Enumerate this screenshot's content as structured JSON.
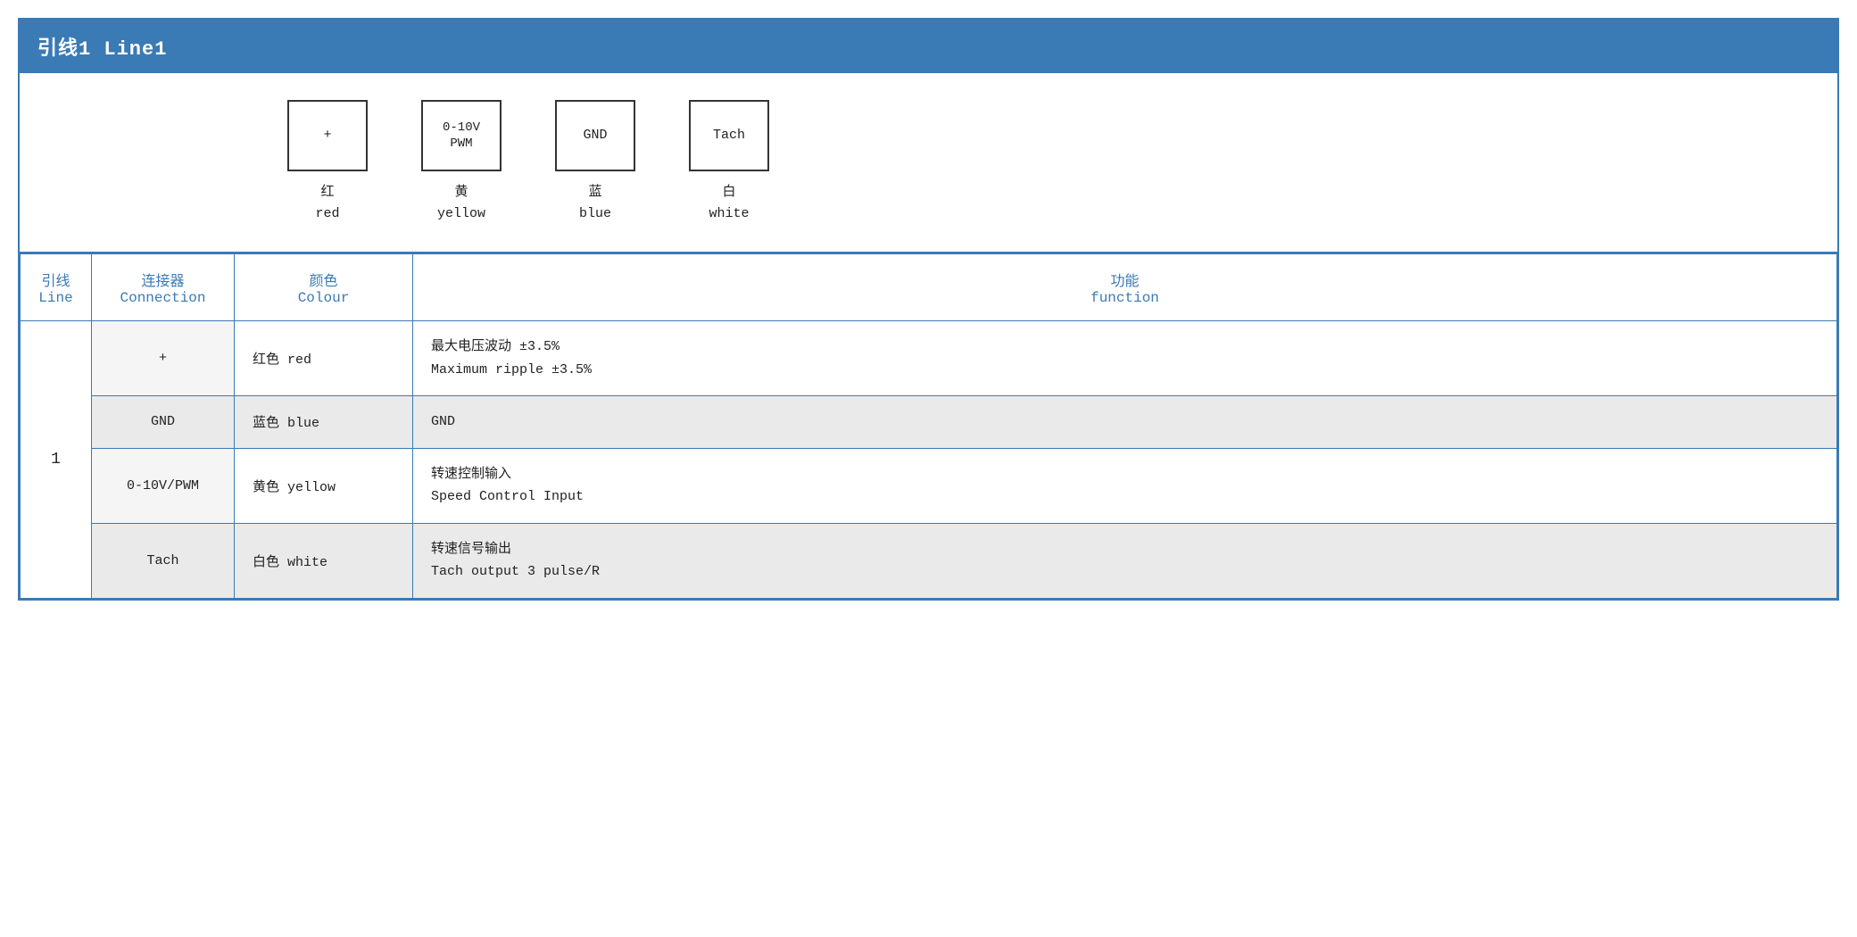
{
  "header": {
    "title": "引线1 Line1"
  },
  "diagram": {
    "connectors": [
      {
        "symbol": "+",
        "label_cn": "红",
        "label_en": "red"
      },
      {
        "symbol": "0-10V\nPWM",
        "label_cn": "黄",
        "label_en": "yellow"
      },
      {
        "symbol": "GND",
        "label_cn": "蓝",
        "label_en": "blue"
      },
      {
        "symbol": "Tach",
        "label_cn": "白",
        "label_en": "white"
      }
    ]
  },
  "table": {
    "headers": {
      "line_cn": "引线",
      "line_en": "Line",
      "connection_cn": "连接器",
      "connection_en": "Connection",
      "colour_cn": "颜色",
      "colour_en": "Colour",
      "function_cn": "功能",
      "function_en": "function"
    },
    "rows": [
      {
        "line": "1",
        "connection": "+",
        "colour": "红色 red",
        "function_cn": "最大电压波动 ±3.5%",
        "function_en": "Maximum ripple ±3.5%",
        "rowspan": 4
      },
      {
        "line": "",
        "connection": "GND",
        "colour": "蓝色 blue",
        "function_cn": "GND",
        "function_en": ""
      },
      {
        "line": "",
        "connection": "0-10V/PWM",
        "colour": "黄色 yellow",
        "function_cn": "转速控制输入",
        "function_en": "Speed Control Input"
      },
      {
        "line": "",
        "connection": "Tach",
        "colour": "白色 white",
        "function_cn": "转速信号输出",
        "function_en": "Tach output 3 pulse/R"
      }
    ]
  }
}
